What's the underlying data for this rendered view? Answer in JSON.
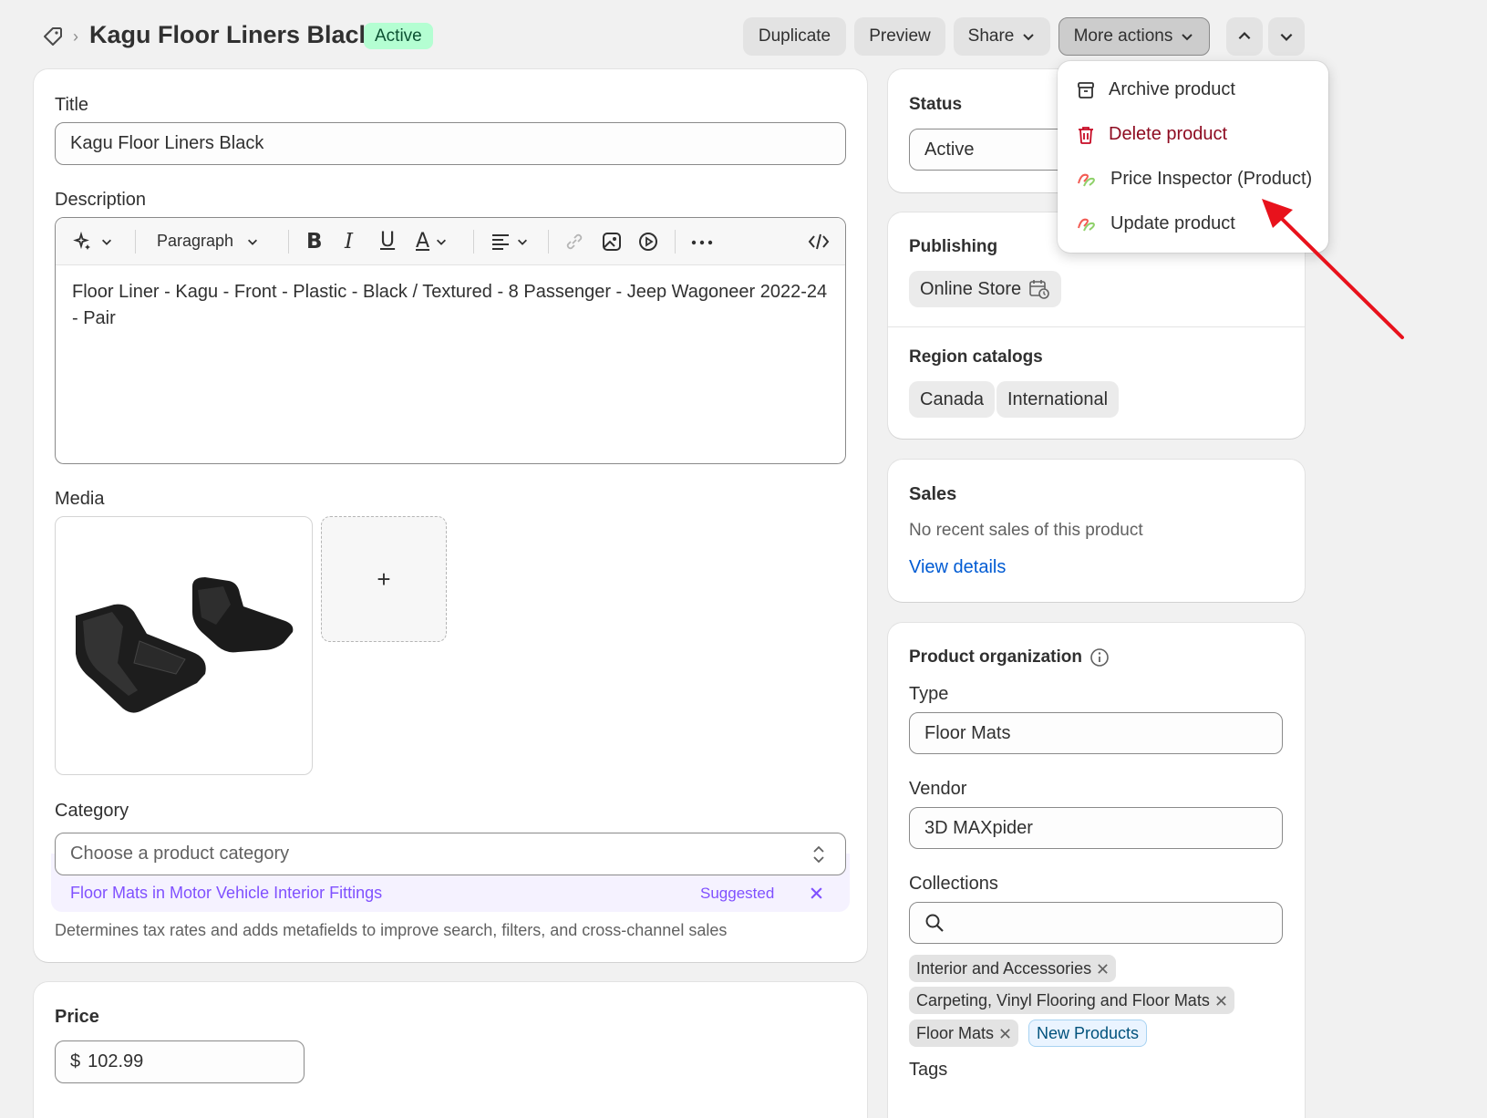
{
  "header": {
    "title": "Kagu Floor Liners Black",
    "status_badge": "Active",
    "buttons": {
      "duplicate": "Duplicate",
      "preview": "Preview",
      "share": "Share",
      "more_actions": "More actions"
    }
  },
  "dropdown": {
    "items": [
      {
        "label": "Archive product",
        "icon": "archive-icon"
      },
      {
        "label": "Delete product",
        "icon": "trash-icon",
        "color": "#8e0b21"
      },
      {
        "label": "Price Inspector (Product)",
        "icon": "app-icon"
      },
      {
        "label": "Update product",
        "icon": "app-icon"
      }
    ]
  },
  "main": {
    "title_label": "Title",
    "title_value": "Kagu Floor Liners Black",
    "description_label": "Description",
    "toolbar": {
      "paragraph": "Paragraph"
    },
    "description_text": "Floor Liner - Kagu - Front - Plastic - Black / Textured - 8 Passenger - Jeep Wagoneer 2022-24 - Pair",
    "media_label": "Media",
    "add_media": "+",
    "category_label": "Category",
    "category_placeholder": "Choose a product category",
    "suggestion_text": "Floor Mats in Motor Vehicle Interior Fittings",
    "suggested_label": "Suggested",
    "category_help": "Determines tax rates and adds metafields to improve search, filters, and cross-channel sales",
    "price_label": "Price",
    "currency": "$",
    "price_value": "102.99"
  },
  "sidebar": {
    "status_label": "Status",
    "status_value": "Active",
    "publishing_label": "Publishing",
    "online_store": "Online Store",
    "region_catalogs_label": "Region catalogs",
    "regions": [
      "Canada",
      "International"
    ],
    "sales_label": "Sales",
    "sales_text": "No recent sales of this product",
    "view_details": "View details",
    "org_label": "Product organization",
    "type_label": "Type",
    "type_value": "Floor Mats",
    "vendor_label": "Vendor",
    "vendor_value": "3D MAXpider",
    "collections_label": "Collections",
    "collections": [
      "Interior and Accessories",
      "Carpeting, Vinyl Flooring and Floor Mats",
      "Floor Mats"
    ],
    "new_collection": "New Products",
    "tags_label": "Tags"
  },
  "colors": {
    "active_badge_bg": "#b4fed2",
    "active_badge_text": "#0c5132",
    "link": "#005bd3",
    "suggestion": "#8051ff",
    "arrow": "#e8121c"
  }
}
